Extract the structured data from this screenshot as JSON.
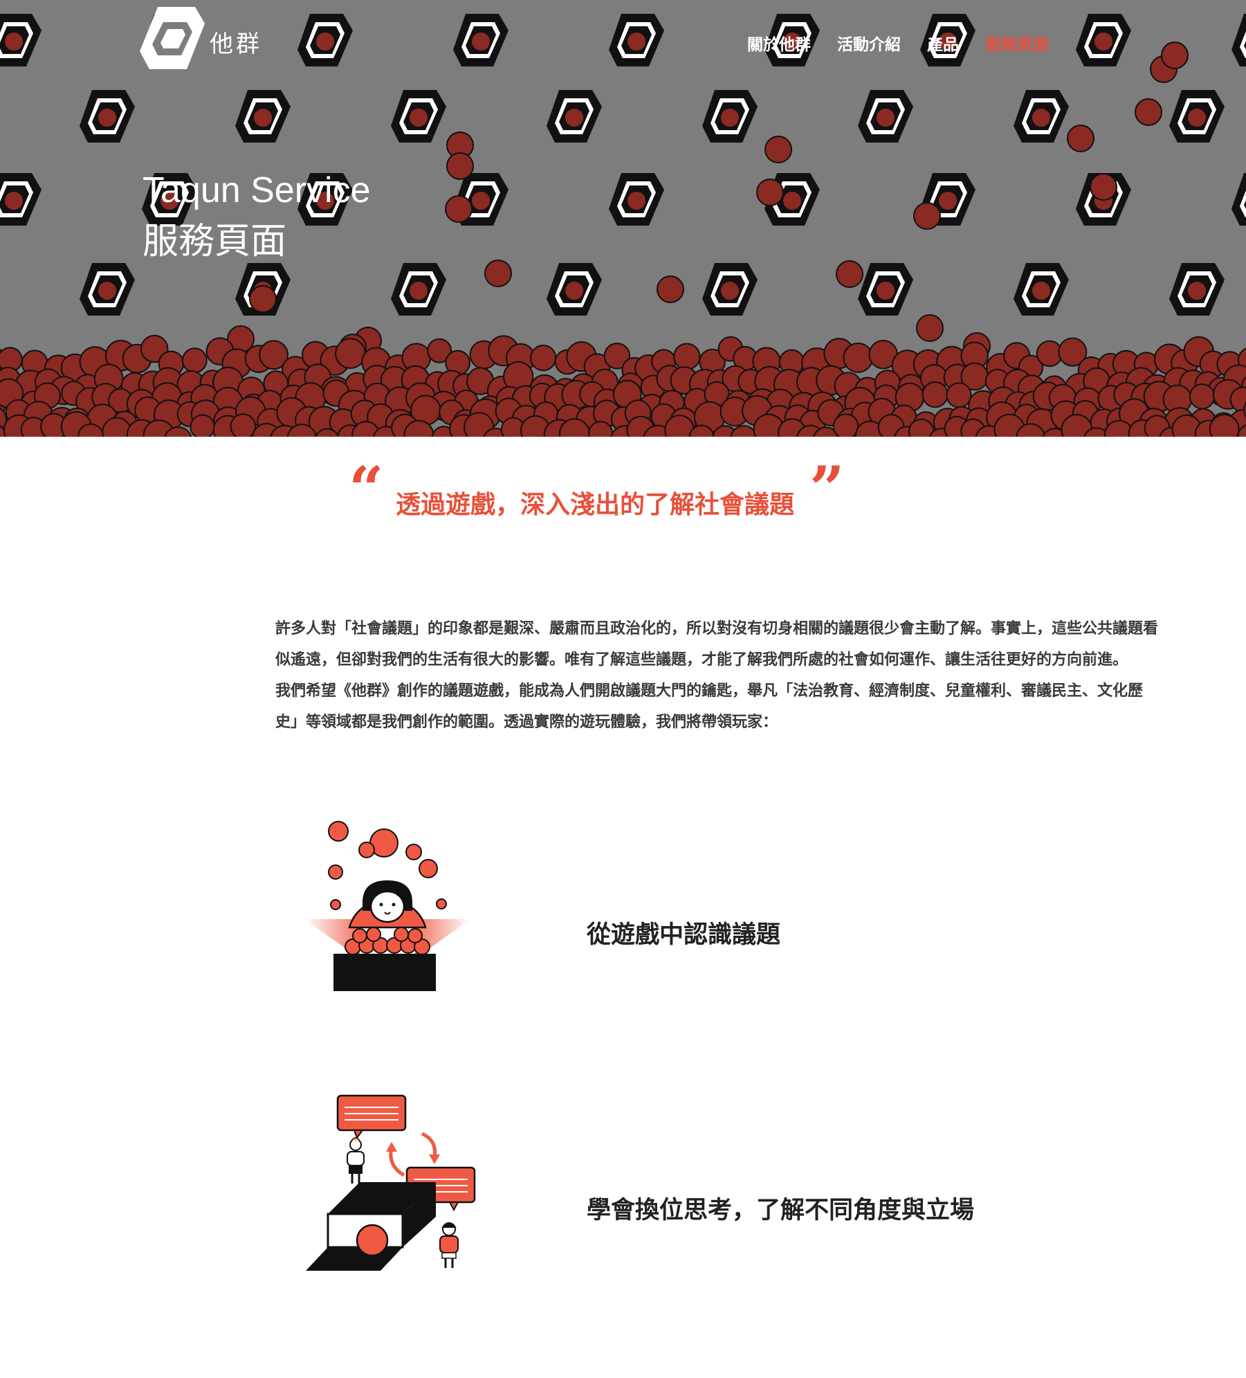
{
  "brand": {
    "name": "他群"
  },
  "nav": {
    "items": [
      {
        "label": "關於他群"
      },
      {
        "label": "活動介紹"
      },
      {
        "label": "產品"
      },
      {
        "label": "服務頁面",
        "active": true
      }
    ]
  },
  "hero": {
    "title_en": "Taqun Service",
    "title_zh": "服務頁面"
  },
  "quote": {
    "open_mark": "“",
    "text": "透過遊戲，深入淺出的了解社會議題",
    "close_mark": "”"
  },
  "intro": {
    "paragraph_1": "許多人對「社會議題」的印象都是艱深、嚴肅而且政治化的，所以對沒有切身相關的議題很少會主動了解。事實上，這些公共議題看似遙遠，但卻對我們的生活有很大的影響。唯有了解這些議題，才能了解我們所處的社會如何運作、讓生活往更好的方向前進。",
    "paragraph_2": "我們希望《他群》創作的議題遊戲，能成為人們開啟議題大門的鑰匙，舉凡「法治教育、經濟制度、兒童權利、審議民主、文化歷史」等領域都是我們創作的範圍。透過實際的遊玩體驗，我們將帶領玩家："
  },
  "features": [
    {
      "title": "從遊戲中認識議題",
      "icon": "juggling-box-illustration-icon"
    },
    {
      "title": "學會換位思考，了解不同角度與立場",
      "icon": "perspective-swap-illustration-icon"
    }
  ],
  "colors": {
    "accent": "#e8503a",
    "hero_bg": "#7d7d7d",
    "ball": "#8a2a22",
    "text": "#3a3a3a"
  }
}
